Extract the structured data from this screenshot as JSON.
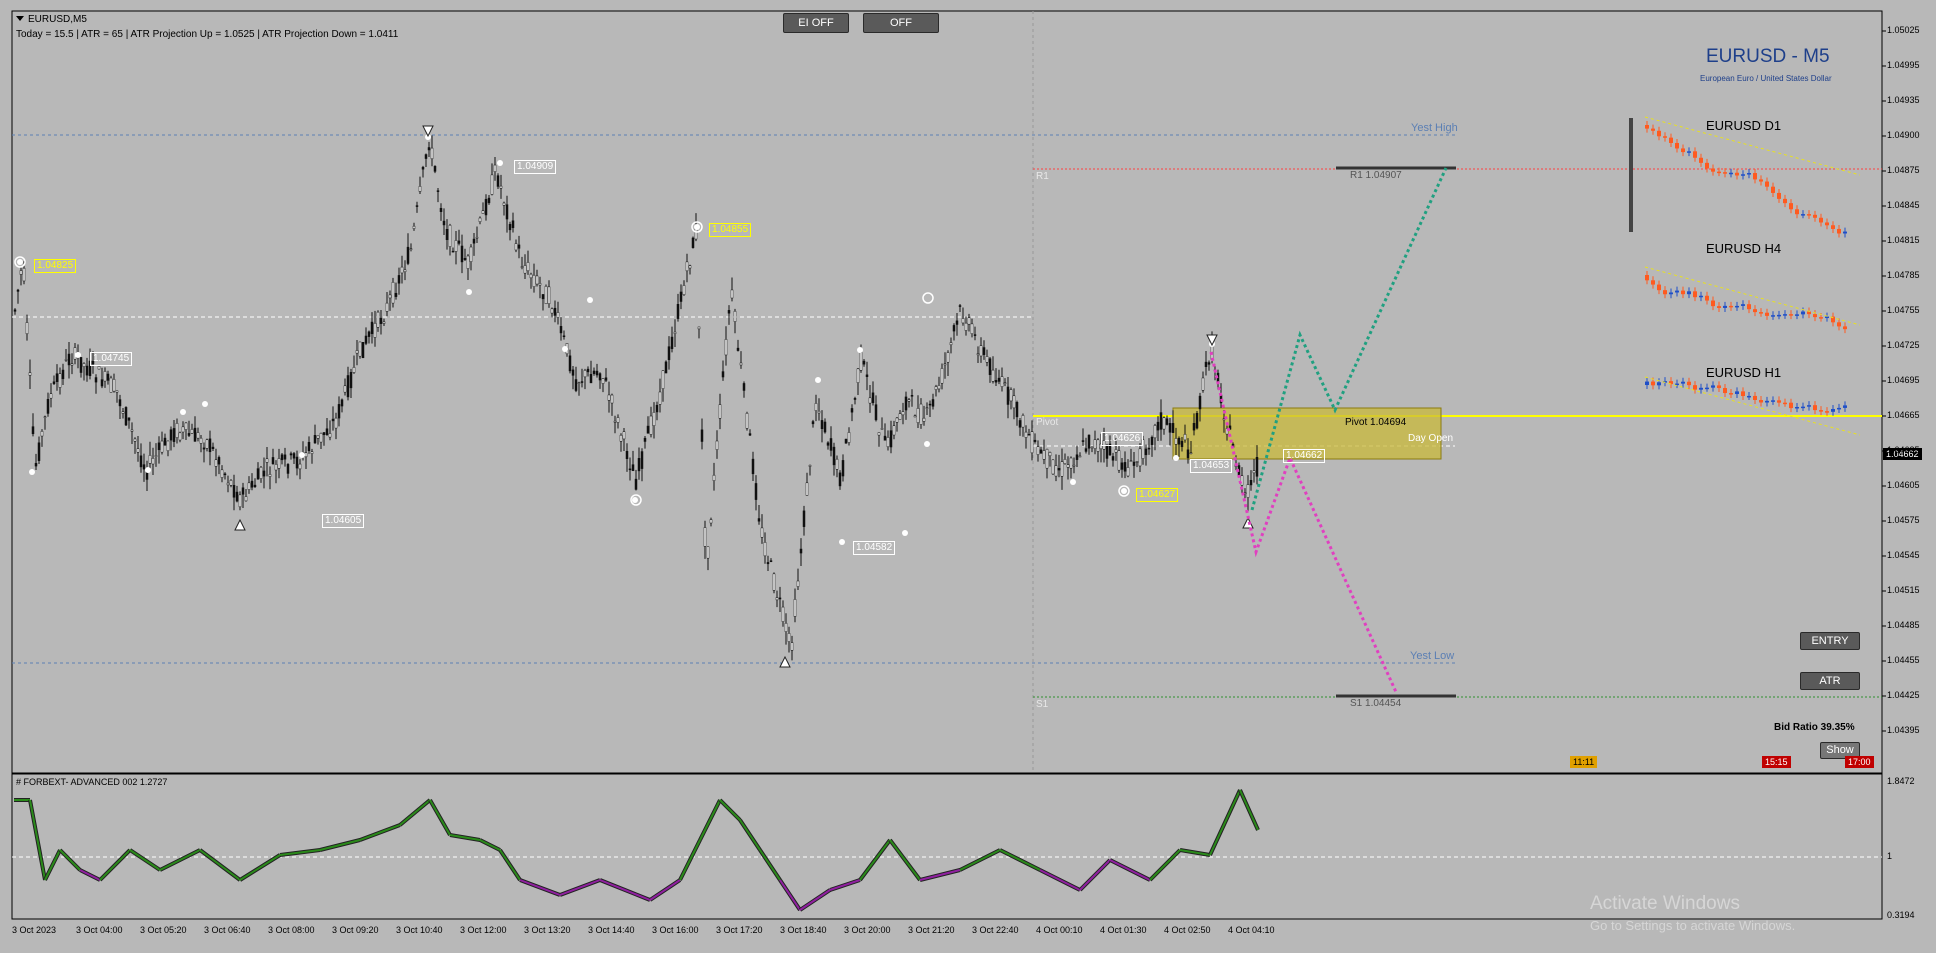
{
  "symbol_header": "EURUSD,M5",
  "info_bar": "Today = 15.5   |   ATR = 65   |   ATR Projection Up = 1.0525   |   ATR Projection Down = 1.0411",
  "buttons": {
    "ei_off": "EI OFF",
    "off": "OFF",
    "entry": "ENTRY",
    "atr": "ATR",
    "show": "Show"
  },
  "panel": {
    "title": "EURUSD - M5",
    "subtitle": "European Euro / United States Dollar",
    "tf_d1": "EURUSD D1",
    "tf_h4": "EURUSD H4",
    "tf_h1": "EURUSD H1"
  },
  "levels": {
    "yest_high": "Yest High",
    "r1_left": "R1",
    "r1": "R1 1.04907",
    "pivot_left": "Pivot",
    "pivot": "Pivot 1.04694",
    "day_open": "Day Open",
    "yest_low": "Yest Low",
    "s1_left": "S1",
    "s1": "S1 1.04454"
  },
  "price_tags": [
    {
      "text": "1.04909",
      "style": "w"
    },
    {
      "text": "1.04855",
      "style": "y"
    },
    {
      "text": "1.04825",
      "style": "y"
    },
    {
      "text": "1.04745",
      "style": "w"
    },
    {
      "text": "1.04605",
      "style": "w"
    },
    {
      "text": "1.04582",
      "style": "w"
    },
    {
      "text": "1.04626",
      "style": "w"
    },
    {
      "text": "1.04653",
      "style": "w"
    },
    {
      "text": "1.04627",
      "style": "y"
    },
    {
      "text": "1.04662",
      "style": "w"
    }
  ],
  "current_price": "1.04662",
  "bid_ratio": "Bid Ratio 39.35%",
  "time_tags": [
    "11:11",
    "15:15",
    "17:00"
  ],
  "price_axis": [
    "1.05025",
    "1.04995",
    "1.04935",
    "1.04900",
    "1.04875",
    "1.04845",
    "1.04815",
    "1.04785",
    "1.04755",
    "1.04725",
    "1.04695",
    "1.04665",
    "1.04635",
    "1.04605",
    "1.04575",
    "1.04545",
    "1.04515",
    "1.04485",
    "1.04455",
    "1.04425",
    "1.04395"
  ],
  "indicator": {
    "title": "# FORBEXT- ADVANCED 002  1.2727",
    "axis_top": "1.8472",
    "axis_mid": "1",
    "axis_bot": "0.3194"
  },
  "time_axis": [
    "3 Oct 2023",
    "3 Oct 04:00",
    "3 Oct 05:20",
    "3 Oct 06:40",
    "3 Oct 08:00",
    "3 Oct 09:20",
    "3 Oct 10:40",
    "3 Oct 12:00",
    "3 Oct 13:20",
    "3 Oct 14:40",
    "3 Oct 16:00",
    "3 Oct 17:20",
    "3 Oct 18:40",
    "3 Oct 20:00",
    "3 Oct 21:20",
    "3 Oct 22:40",
    "4 Oct 00:10",
    "4 Oct 01:30",
    "4 Oct 02:50",
    "4 Oct 04:10"
  ],
  "watermark": {
    "line1": "Activate Windows",
    "line2": "Go to Settings to activate Windows."
  },
  "colors": {
    "bg": "#b8b8b8",
    "pivot": "#ffff00",
    "r1": "#ff4040",
    "s1": "#2f8f2f",
    "up_proj": "#20a080",
    "down_proj": "#e040c0",
    "bull": "#1f4fc8",
    "bear": "#ff5a1f"
  }
}
